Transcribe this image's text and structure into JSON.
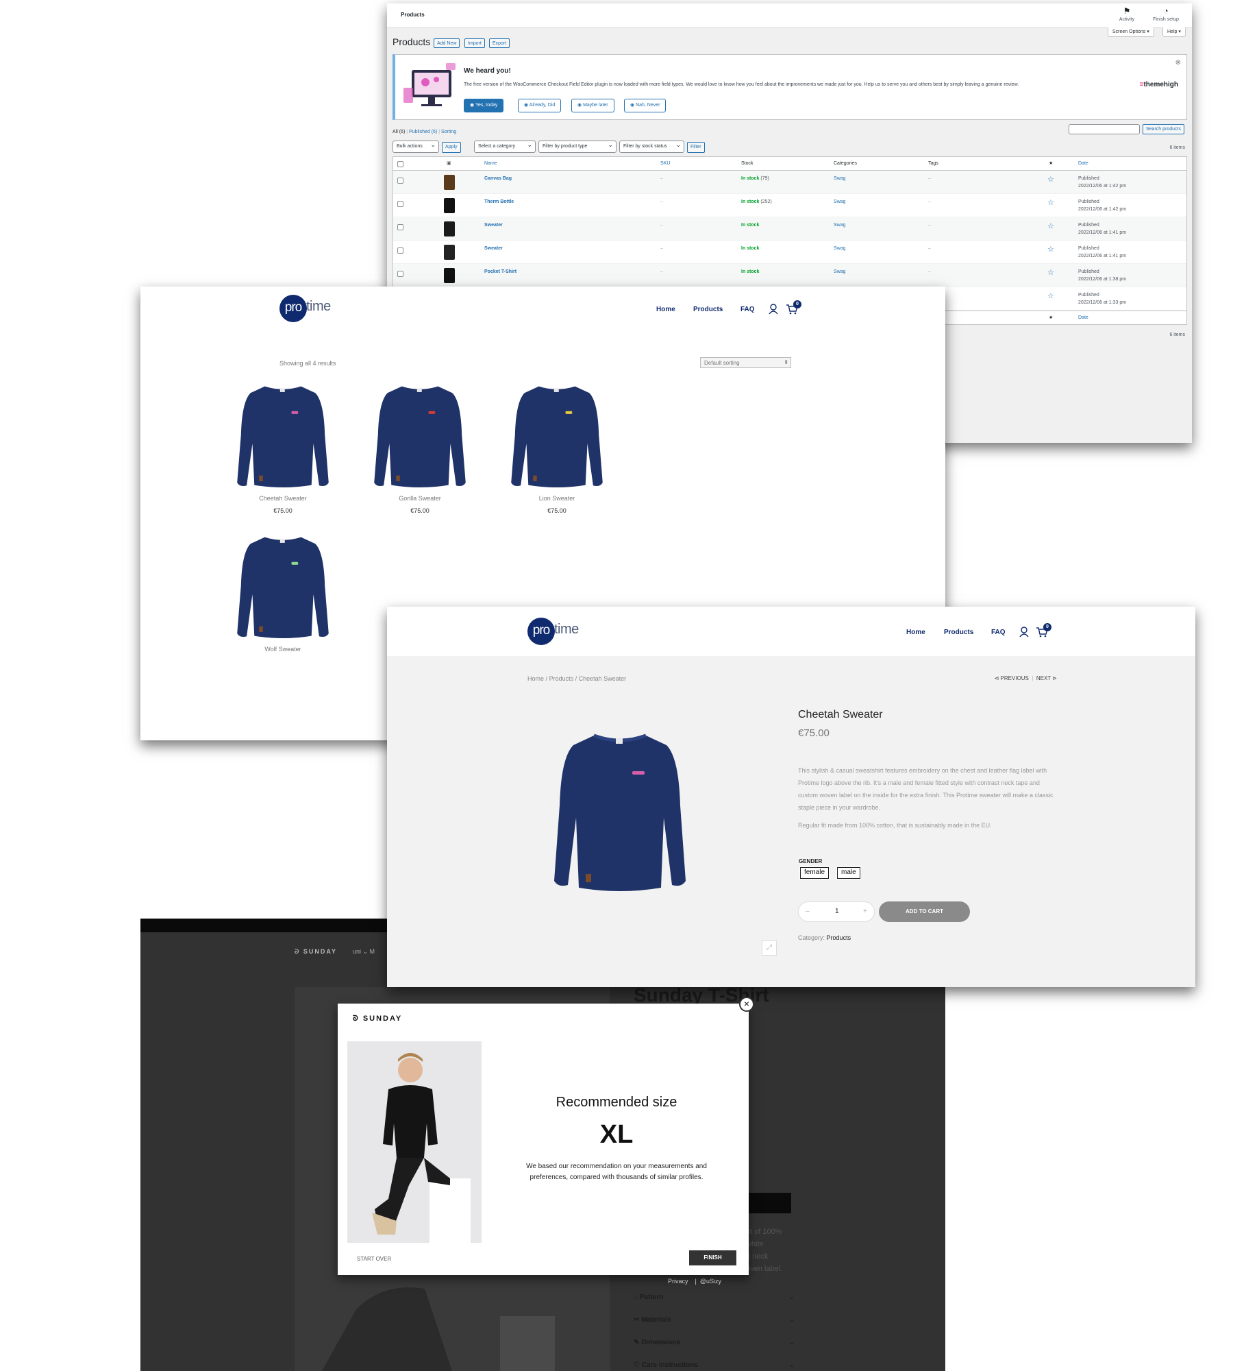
{
  "wp": {
    "breadcrumb": "Products",
    "activity": "Activity",
    "finish_setup": "Finish setup",
    "screen_options": "Screen Options ▾",
    "help": "Help ▾",
    "page_title": "Products",
    "add_new": "Add New",
    "import": "Import",
    "export": "Export",
    "notice": {
      "title": "We heard you!",
      "text": "The free version of the WooCommerce Checkout Field Editor plugin is now loaded with more field types. We would love to know how you feel about the improvements we made just for you. Help us to serve you and others best by simply leaving a genuine review.",
      "yes": "Yes, today",
      "already": "Already, Did",
      "maybe": "Maybe later",
      "never": "Nah, Never",
      "brand_prefix": "≡",
      "brand": "themehigh"
    },
    "filters": {
      "all": "All (6)",
      "sep1": "|",
      "published": "Published (6)",
      "sep2": "|",
      "sorting": "Sorting",
      "search_button": "Search products",
      "bulk": "Bulk actions",
      "apply": "Apply",
      "category": "Select a category",
      "type": "Filter by product type",
      "stock": "Filter by stock status",
      "filter": "Filter",
      "count": "6 items"
    },
    "columns": {
      "name": "Name",
      "sku": "SKU",
      "stock": "Stock",
      "categories": "Categories",
      "tags": "Tags",
      "featured": "★",
      "date": "Date"
    },
    "rows": [
      {
        "name": "Canvas Bag",
        "sku": "–",
        "stock": "In stock",
        "qty": "(79)",
        "cat": "Swag",
        "tags": "–",
        "star": "☆",
        "status": "Published",
        "date": "2022/12/06 at 1:42 pm",
        "thumb": "#5a3a1a"
      },
      {
        "name": "Therm Bottle",
        "sku": "–",
        "stock": "In stock",
        "qty": "(252)",
        "cat": "Swag",
        "tags": "–",
        "star": "☆",
        "status": "Published",
        "date": "2022/12/06 at 1:42 pm",
        "thumb": "#111111"
      },
      {
        "name": "Sweater",
        "sku": "–",
        "stock": "In stock",
        "qty": "",
        "cat": "Swag",
        "tags": "–",
        "star": "☆",
        "status": "Published",
        "date": "2022/12/06 at 1:41 pm",
        "thumb": "#1a1a1a"
      },
      {
        "name": "Sweater",
        "sku": "–",
        "stock": "In stock",
        "qty": "",
        "cat": "Swag",
        "tags": "–",
        "star": "☆",
        "status": "Published",
        "date": "2022/12/06 at 1:41 pm",
        "thumb": "#222222"
      },
      {
        "name": "Pocket T-Shirt",
        "sku": "–",
        "stock": "In stock",
        "qty": "",
        "cat": "Swag",
        "tags": "–",
        "star": "☆",
        "status": "Published",
        "date": "2022/12/06 at 1:38 pm",
        "thumb": "#111111"
      },
      {
        "name": "",
        "sku": "",
        "stock": "",
        "qty": "",
        "cat": "",
        "tags": "",
        "star": "☆",
        "status": "Published",
        "date": "2022/12/06 at 1:33 pm",
        "thumb": "#ffffff"
      }
    ],
    "footer_star": "★",
    "footer_date": "Date",
    "footer_count": "6 items"
  },
  "shop": {
    "logo_pro": "pro",
    "logo_time": "time",
    "nav": [
      "Home",
      "Products",
      "FAQ"
    ],
    "cart_count": "0",
    "showing": "Showing all 4 results",
    "sorting": "Default sorting",
    "products": [
      {
        "name": "Cheetah Sweater",
        "price": "€75.00",
        "badge": "#d55fa8"
      },
      {
        "name": "Gorilla Sweater",
        "price": "€75.00",
        "badge": "#d63b3b"
      },
      {
        "name": "Lion Sweater",
        "price": "€75.00",
        "badge": "#e8c93a"
      },
      {
        "name": "Wolf Sweater",
        "price": "",
        "badge": "#8fd694"
      }
    ]
  },
  "pdp": {
    "nav": [
      "Home",
      "Products",
      "FAQ"
    ],
    "cart_count": "0",
    "breadcrumb": [
      "Home",
      "/",
      "Products",
      "/",
      "Cheetah Sweater"
    ],
    "previous": "PREVIOUS",
    "sep": "|",
    "next": "NEXT",
    "title": "Cheetah Sweater",
    "price": "€75.00",
    "description": "This stylish & casual sweatshirt features embroidery on the chest and leather flag label with Protime logo above the rib. It's a male and female fitted style with contrast neck tape and custom woven label on the inside for the extra finish. This Protime sweater will make a classic staple piece in your wardrobe.",
    "description2": "Regular fit made from 100% cotton, that is sustainably made in the EU.",
    "gender_label": "GENDER",
    "genders": [
      "female",
      "male"
    ],
    "qty_minus": "–",
    "qty": "1",
    "qty_plus": "+",
    "add_to_cart": "ADD TO CART",
    "category_label": "Category:",
    "category": "Products"
  },
  "sunday": {
    "brand": "SUNDAY",
    "menu1": "uni ⌄   M",
    "heading": "Sunday T-Shirt",
    "desc_lines": [
      "ut of 100%",
      "white",
      "e neck",
      "oven label."
    ],
    "privacy": "Privacy",
    "sep": "|",
    "usizy": "@uSizy",
    "accordion": [
      "Pattern",
      "Materials",
      "Dimensions",
      "Care instructions"
    ]
  },
  "modal": {
    "brand": "SUNDAY",
    "close": "×",
    "recommended": "Recommended size",
    "size": "XL",
    "text": "We based our recommendation on your measurements and preferences, compared with thousands of similar profiles.",
    "start_over": "START OVER",
    "finish": "FINISH"
  }
}
